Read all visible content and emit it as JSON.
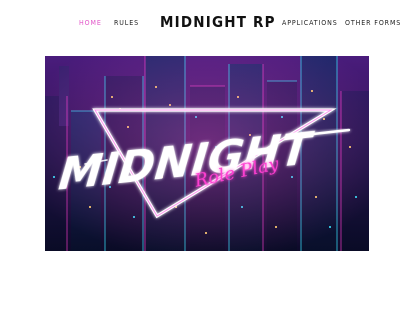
{
  "nav": {
    "home": "HOME",
    "rules": "RULES",
    "applications": "APPLICATIONS",
    "other_forms": "OTHER FORMS"
  },
  "site_title": "MIDNIGHT RP",
  "hero": {
    "logo_main": "MIDNIGHT",
    "logo_sub": "Role Play"
  },
  "colors": {
    "accent": "#e255c9",
    "text": "#222222",
    "background": "#ffffff",
    "neon_pink": "#ff3fd2",
    "neon_cyan": "#37e6ff",
    "sky_purple": "#3a1667"
  }
}
